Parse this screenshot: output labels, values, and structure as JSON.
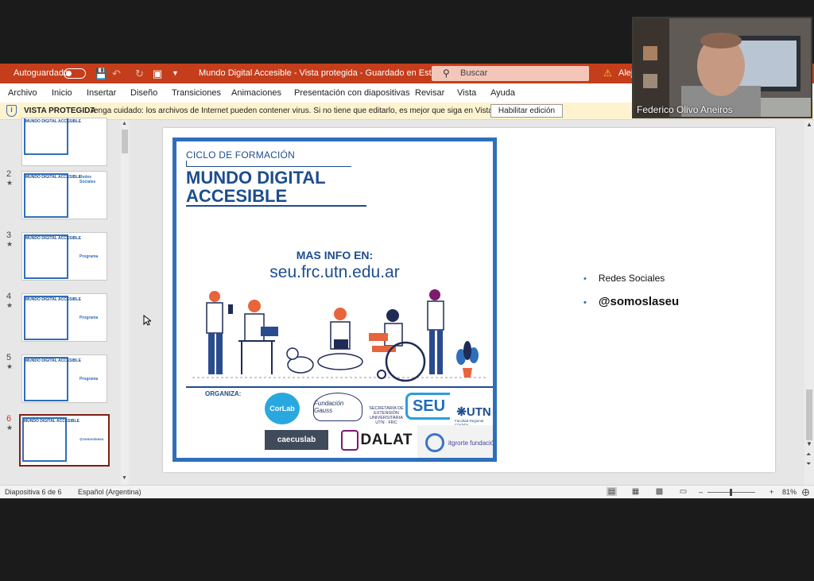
{
  "titlebar": {
    "autosave_label": "Autoguardado",
    "doc_title": "Mundo Digital Accesible  -  Vista protegida  -  Guardado en Este PC",
    "search_placeholder": "Buscar",
    "user_name": "Alej"
  },
  "ribbon": {
    "tabs": [
      "Archivo",
      "Inicio",
      "Insertar",
      "Diseño",
      "Transiciones",
      "Animaciones",
      "Presentación con diapositivas",
      "Revisar",
      "Vista",
      "Ayuda"
    ]
  },
  "protected_view": {
    "title": "VISTA PROTEGIDA",
    "message": "Tenga cuidado: los archivos de Internet pueden contener virus. Si no tiene que editarlo, es mejor que siga en Vista protegida.",
    "button": "Habilitar edición"
  },
  "thumbnails": [
    {
      "number": "",
      "title": "MUNDO DIGITAL ACCESIBLE",
      "right": ""
    },
    {
      "number": "2",
      "title": "MUNDO DIGITAL ACCESIBLE",
      "right": "Redes Sociales"
    },
    {
      "number": "3",
      "title": "MUNDO DIGITAL ACCESIBLE",
      "right": "Programa"
    },
    {
      "number": "4",
      "title": "MUNDO DIGITAL ACCESIBLE",
      "right": "Programa"
    },
    {
      "number": "5",
      "title": "MUNDO DIGITAL ACCESIBLE",
      "right": "Programa"
    },
    {
      "number": "6",
      "title": "MUNDO DIGITAL ACCESIBLE",
      "right": "@somoslaseu"
    }
  ],
  "slide": {
    "poster": {
      "cycle": "CICLO DE FORMACIÓN",
      "title_line1": "MUNDO DIGITAL",
      "title_line2": "ACCESIBLE",
      "info": "MAS INFO EN:",
      "url": "seu.frc.utn.edu.ar",
      "organiza": "ORGANIZA:",
      "logos": {
        "corlab": "CorLab",
        "gauss": "Fundación Gauss",
        "secretaria": "SECRETARÍA DE EXTENSIÓN UNIVERSITARIA UTN · FRC",
        "seu": "SEU",
        "utn": "UTN",
        "utn_sub": "Facultad Regional Córdoba",
        "caecus": "caecuslab",
        "dalat": "DALAT",
        "itgrorte": "itgrorte fundación"
      }
    },
    "bullets": [
      "Redes Sociales",
      "@somoslaseu"
    ]
  },
  "status": {
    "slide_info": "Diapositiva 6 de 6",
    "language": "Español (Argentina)",
    "zoom": "81%"
  },
  "video": {
    "participant": "Federico Olivo Aneiros"
  }
}
